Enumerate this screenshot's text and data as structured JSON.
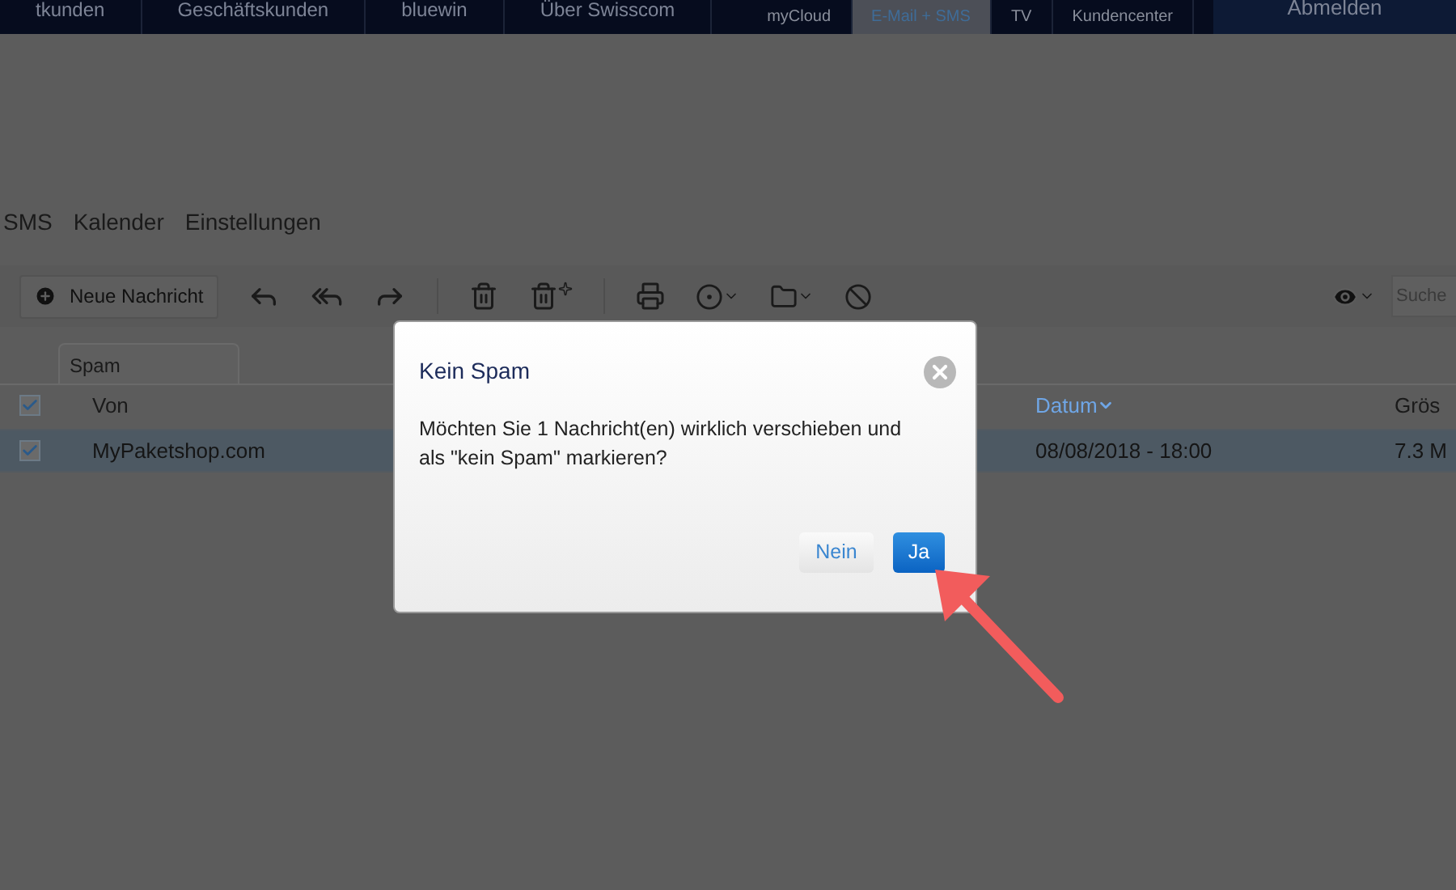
{
  "top_nav": {
    "left_items": [
      "tkunden",
      "Geschäftskunden",
      "bluewin",
      "Über Swisscom"
    ],
    "right_items": [
      {
        "label": "myCloud",
        "selected": false
      },
      {
        "label": "E-Mail + SMS",
        "selected": true
      },
      {
        "label": "TV",
        "selected": false
      },
      {
        "label": "Kundencenter",
        "selected": false
      }
    ],
    "logout": "Abmelden"
  },
  "app_nav": [
    "SMS",
    "Kalender",
    "Einstellungen"
  ],
  "toolbar": {
    "new_message": "Neue Nachricht",
    "search": {
      "placeholder": "Suche"
    }
  },
  "folder_tab": "Spam",
  "table": {
    "header_checked": true,
    "columns": [
      {
        "label": "Von",
        "sorted": false
      },
      {
        "label": "Datum",
        "sorted": true
      },
      {
        "label": "Grös",
        "sorted": false
      }
    ],
    "rows": [
      {
        "checked": true,
        "selected": true,
        "from": "MyPaketshop.com",
        "date": "08/08/2018 - 18:00",
        "size": "7.3 M"
      }
    ]
  },
  "dialog": {
    "title": "Kein Spam",
    "message": "Möchten Sie 1 Nachricht(en) wirklich verschieben und als \"kein Spam\" markieren?",
    "buttons": [
      {
        "label": "Nein",
        "kind": "secondary"
      },
      {
        "label": "Ja",
        "kind": "primary"
      }
    ]
  }
}
